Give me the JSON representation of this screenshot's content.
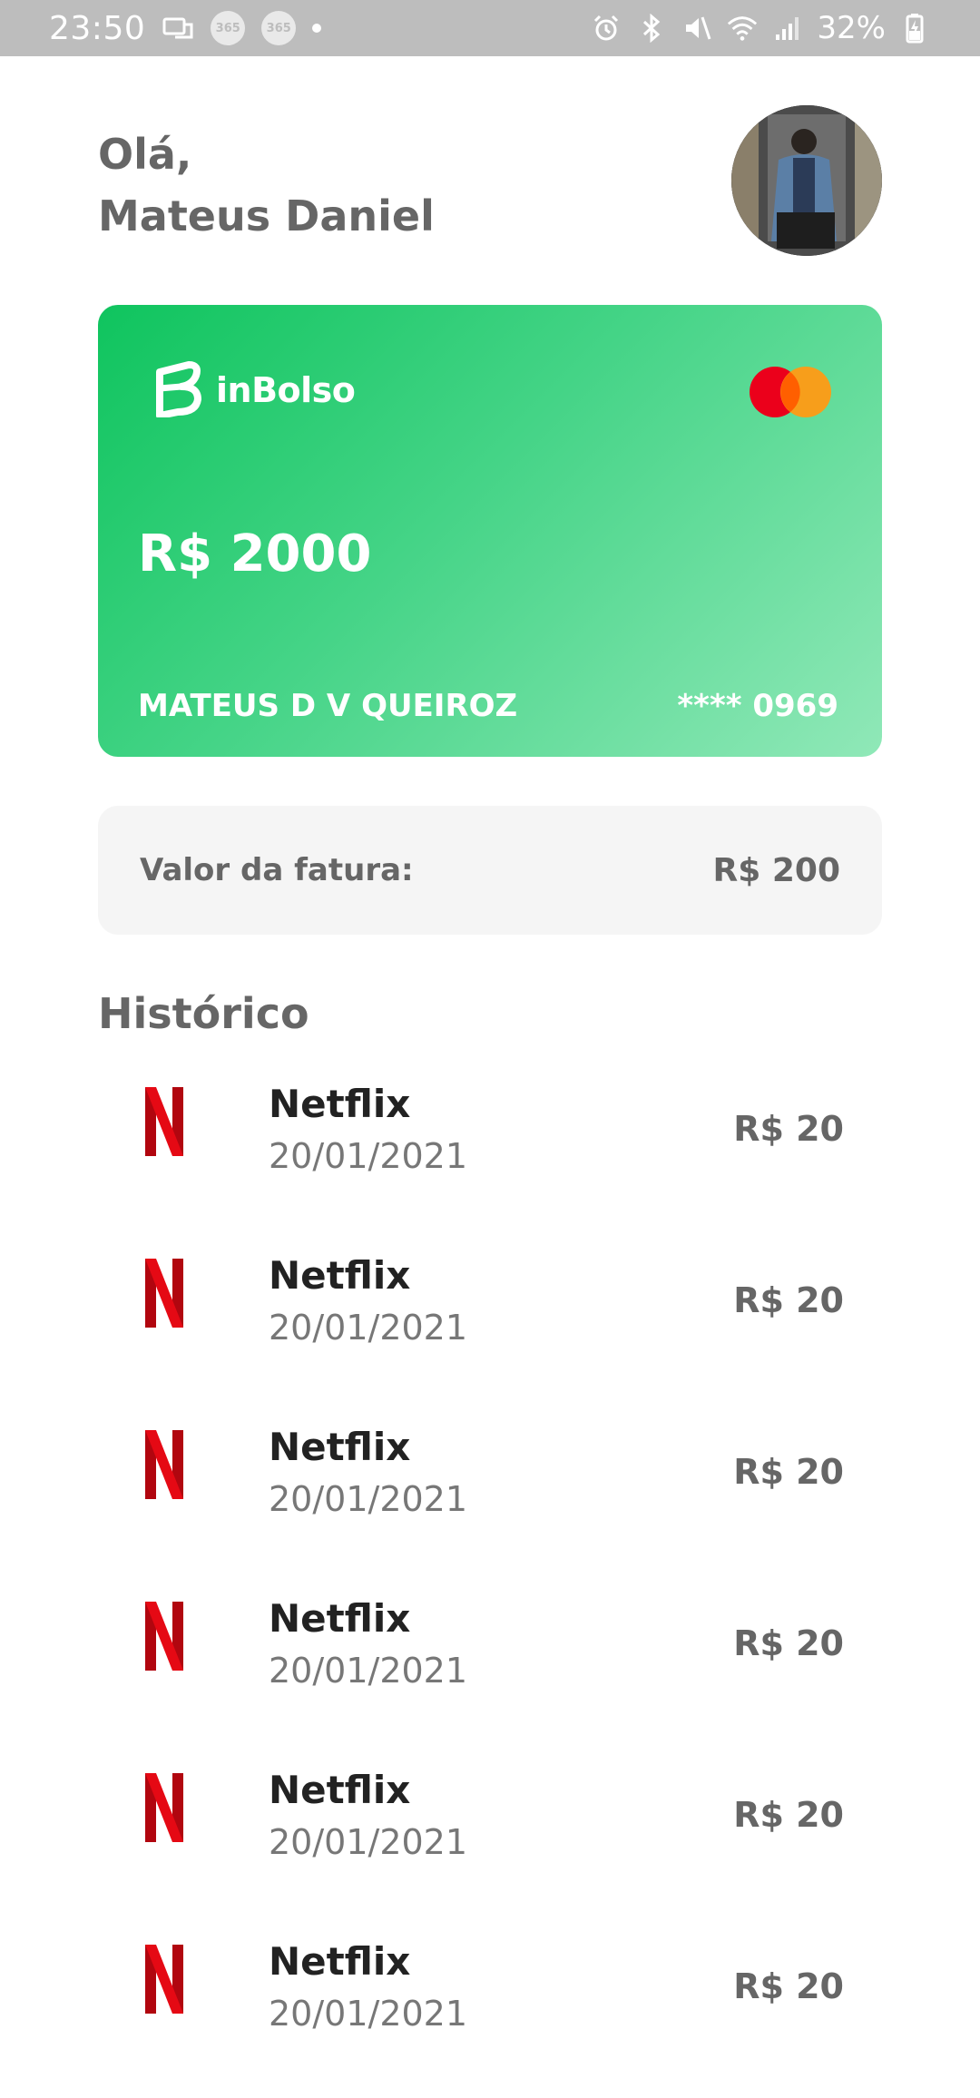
{
  "status_bar": {
    "time": "23:50",
    "badge_1": "365",
    "badge_2": "365",
    "battery": "32%",
    "icons": [
      "messages-icon",
      "alarm-icon",
      "bluetooth-icon",
      "mute-icon",
      "wifi-icon",
      "signal-icon",
      "battery-charging-icon"
    ]
  },
  "greeting": {
    "line1": "Olá,",
    "line2": "Mateus Daniel"
  },
  "card": {
    "brand": "inBolso",
    "balance": "R$ 2000",
    "holder": "MATEUS D V QUEIROZ",
    "number": "**** 0969",
    "network_icon": "mastercard-icon",
    "colors": {
      "start": "#0fc45e",
      "end": "#90e8b8"
    }
  },
  "invoice": {
    "label": "Valor da fatura:",
    "value": "R$ 200"
  },
  "history": {
    "title": "Histórico",
    "items": [
      {
        "name": "Netflix",
        "date": "20/01/2021",
        "amount": "R$ 20",
        "icon": "netflix-icon"
      },
      {
        "name": "Netflix",
        "date": "20/01/2021",
        "amount": "R$ 20",
        "icon": "netflix-icon"
      },
      {
        "name": "Netflix",
        "date": "20/01/2021",
        "amount": "R$ 20",
        "icon": "netflix-icon"
      },
      {
        "name": "Netflix",
        "date": "20/01/2021",
        "amount": "R$ 20",
        "icon": "netflix-icon"
      },
      {
        "name": "Netflix",
        "date": "20/01/2021",
        "amount": "R$ 20",
        "icon": "netflix-icon"
      },
      {
        "name": "Netflix",
        "date": "20/01/2021",
        "amount": "R$ 20",
        "icon": "netflix-icon"
      }
    ]
  }
}
